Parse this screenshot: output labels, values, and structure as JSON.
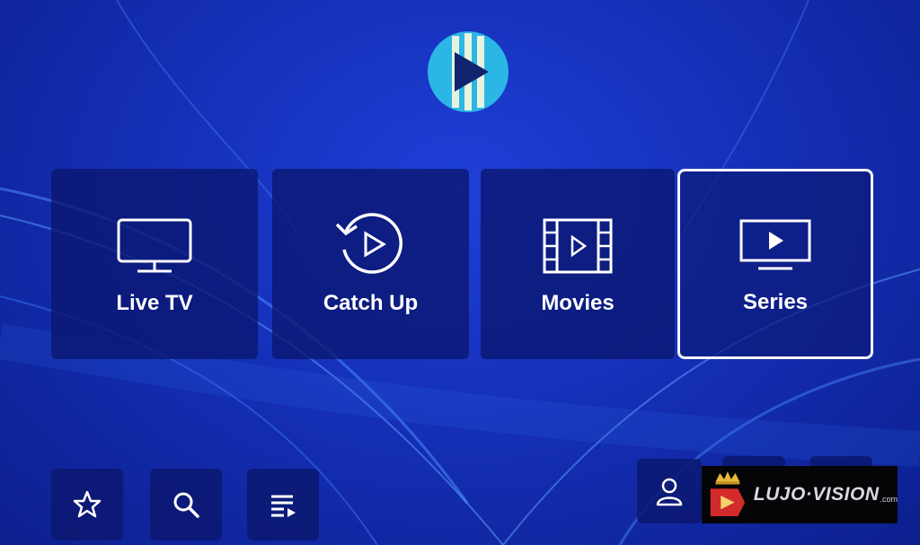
{
  "menu": {
    "tiles": [
      {
        "label": "Live TV",
        "icon": "tv-icon"
      },
      {
        "label": "Catch Up",
        "icon": "history-play-icon"
      },
      {
        "label": "Movies",
        "icon": "film-icon"
      },
      {
        "label": "Series",
        "icon": "series-tv-icon"
      }
    ],
    "selected_index": 3
  },
  "bottom_bar": {
    "left": [
      "star-icon",
      "search-icon",
      "playlist-icon"
    ],
    "right": [
      "user-icon"
    ]
  },
  "watermark": {
    "text": "LUJO·VISION",
    "domain": ".com"
  },
  "colors": {
    "background": "#1530b8",
    "tile": "#0a166e",
    "logo_blue": "#2bb6e6",
    "highlight": "#f4f6ff"
  }
}
